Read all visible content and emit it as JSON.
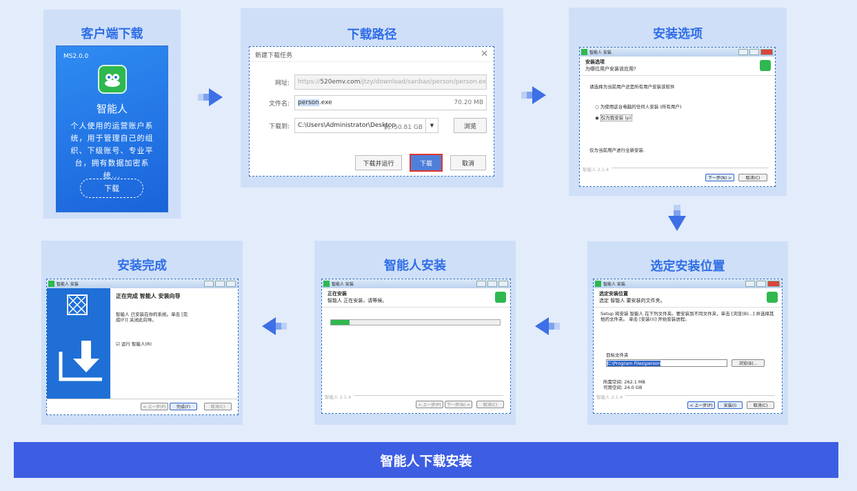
{
  "steps": {
    "s1": {
      "title": "客户端下载",
      "version": "MS2.0.0",
      "app_name": "智能人",
      "description": "个人使用的运营账户系统，用于管理自己的组织、下级账号、专业平台，拥有数据加密系统...",
      "download_label": "下载"
    },
    "s2": {
      "title": "下载路径",
      "dialog_title": "新建下载任务",
      "url_label": "网址:",
      "url_prefix": "https://",
      "url_host": "520emv.com",
      "url_path": "/jtzy/download/sanbao/person/person.exe",
      "filename_label": "文件名:",
      "filename_selected": "person",
      "filename_ext": ".exe",
      "file_size": "70.20 MB",
      "saveto_label": "下载到:",
      "saveto_path": "C:\\Users\\Administrator\\Desktop",
      "free_space": "剩: 50.81 GB",
      "browse_label": "浏览",
      "run_after_label": "下载并运行",
      "download_label": "下载",
      "cancel_label": "取消"
    },
    "s3": {
      "title": "安装选项",
      "window_title": "智能人 安装",
      "head_bold": "安装选项",
      "head_sub": "为哪位用户安装该应用?",
      "prompt": "请选择为当前用户还是所有用户安装该软件",
      "option_all": "为使用这台电脑的任何人安装 (所有用户)",
      "option_me": "仅为我安装 (p)",
      "note": "仅为当前用户进行全新安装.",
      "brand": "智能人 2.1.4",
      "next_label": "下一步(N) >",
      "cancel_label": "取消(C)"
    },
    "s4": {
      "title": "选定安装位置",
      "window_title": "智能人 安装",
      "head_bold": "选定安装位置",
      "head_sub": "选定 智能人 要安装的文件夹。",
      "desc": "Setup 将安装 智能人 在下列文件夹。要安装到不同文件夹，单击 [浏览(B)...] 并选择其他的文件夹。 单击 [安装(I)] 开始安装进程。",
      "folder_label": "目标文件夹",
      "folder_value": "C:\\Program Files\\person",
      "browse_label": "浏览(B)...",
      "space_required": "所需空间: 262.1 MB",
      "space_available": "可用空间: 24.0 GB",
      "brand": "智能人 2.1.4",
      "back_label": "< 上一步(P)",
      "install_label": "安装(I)",
      "cancel_label": "取消(C)"
    },
    "s5": {
      "title": "智能人安装",
      "window_title": "智能人 安装",
      "head_bold": "正在安装",
      "head_sub": "智能人 正在安装，请等候。",
      "progress": 0.11,
      "brand": "智能人 2.1.4",
      "back_label": "< 上一步(P)",
      "next_label": "下一步(N) >",
      "cancel_label": "取消(C)"
    },
    "s6": {
      "title": "安装完成",
      "window_title": "智能人 安装",
      "heading": "正在完成 智能人 安装向导",
      "desc": "智能人 已安装在你的系统。单击 [完成(F)] 关闭此向导。",
      "run_label": "运行 智能人(R)",
      "back_label": "< 上一步(P)",
      "finish_label": "完成(F)",
      "cancel_label": "取消(C)"
    }
  },
  "footer": {
    "title": "智能人下载安装"
  },
  "colors": {
    "accent": "#2f6ee6",
    "footer": "#3d5ee3",
    "panel": "#cfdff8",
    "highlight": "#e0352b"
  }
}
